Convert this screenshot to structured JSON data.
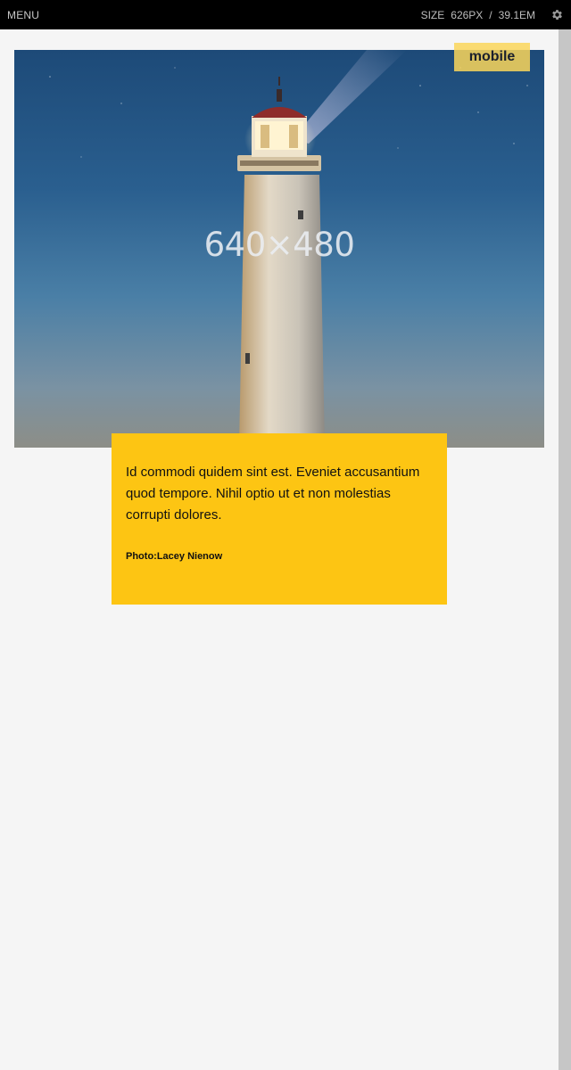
{
  "topbar": {
    "menu_label": "MENU",
    "size_label": "SIZE",
    "size_px": "626PX",
    "size_separator": "/",
    "size_em": "39.1EM",
    "settings_icon": "gear-icon"
  },
  "viewport": {
    "badge_label": "mobile"
  },
  "hero": {
    "placeholder_label": "640×480"
  },
  "caption": {
    "text": "Id commodi quidem sint est. Eveniet accusantium quod tempore. Nihil optio ut et non molestias corrupti dolores.",
    "credit": "Photo:Lacey Nienow"
  },
  "colors": {
    "topbar_bg": "#000000",
    "caption_bg": "#fdc513",
    "badge_bg": "#fad65a",
    "page_bg": "#f5f5f5"
  }
}
